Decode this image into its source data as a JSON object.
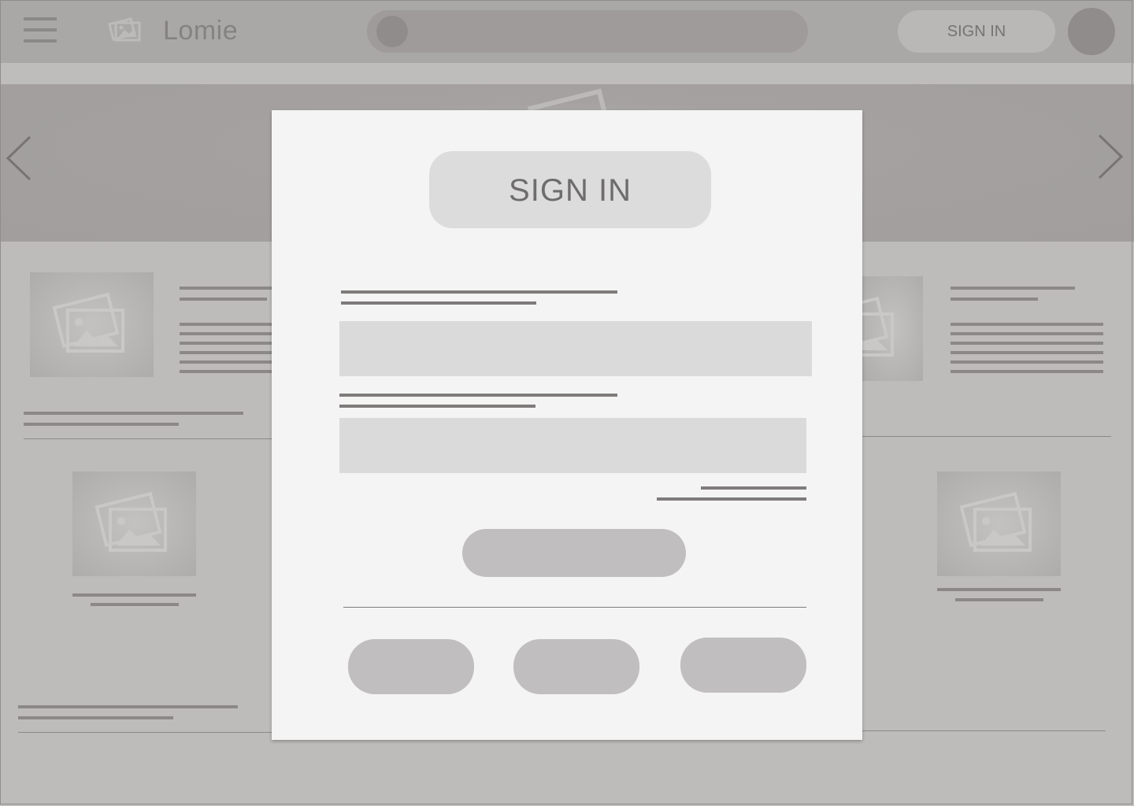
{
  "app": {
    "brand_name": "Lomie",
    "header_signin_label": "SIGN IN"
  },
  "search": {
    "placeholder": ""
  },
  "modal": {
    "title": "SIGN IN",
    "primary_button_label": "",
    "social_buttons": [
      "",
      "",
      ""
    ]
  },
  "icons": {
    "menu": "hamburger-icon",
    "brand": "photo-icon",
    "carousel_prev": "chevron-left-icon",
    "carousel_next": "chevron-right-icon",
    "thumbnail": "image-placeholder-icon"
  },
  "colors": {
    "overlay_background": "#bdbcbb",
    "modal_background": "#f4f4f4",
    "input_fill": "#dadada",
    "button_fill": "#c0bebe",
    "text_gray": "#6f6c6c"
  }
}
